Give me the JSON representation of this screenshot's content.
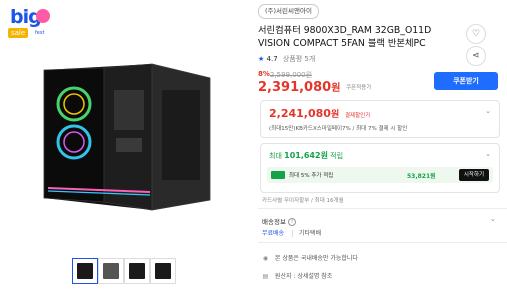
{
  "badge": {
    "big": "big",
    "sale": "sale",
    "tiny": "fest"
  },
  "store": {
    "name": "(주)서린씨앤아이"
  },
  "product": {
    "title": "서린컴퓨터 9800X3D_RAM 32GB_O11D VISION COMPACT 5FAN 블랙 반본체PC",
    "rating": "4.7",
    "review_count": "상품평 5개",
    "discount": "8%",
    "original_price": "2,599,000원",
    "price": "2,391,080",
    "price_unit": "원",
    "price_tag": "쿠폰적용가"
  },
  "actions": {
    "coupon_button": "쿠폰받기",
    "wishlist_icon": "heart-icon",
    "share_icon": "share-icon"
  },
  "benefit_price": {
    "price": "2,241,080",
    "unit": "원",
    "label": "결제할인가",
    "detail": "(최대15만)KB카드X스마일페이7% / 최대 7% 결제 시 할인"
  },
  "points": {
    "label_prefix": "최대",
    "amount": "101,642원",
    "label_suffix": "적립",
    "extra_text": "최대 5% 추가 적립",
    "extra_amount": "53,821원",
    "extra_button": "시작하기"
  },
  "card_info": "카드사별 무이자할부 / 최대 16개월",
  "shipping": {
    "label": "배송정보",
    "free": "무료배송",
    "carrier": "기타택배"
  },
  "info_rows": [
    {
      "icon": "globe-icon",
      "glyph": "◉",
      "text": "본 상품은 국내배송만 가능합니다"
    },
    {
      "icon": "doc-icon",
      "glyph": "▤",
      "text": "원산지 : 상세설명 참조"
    }
  ],
  "thumbnails": [
    {
      "selected": true
    },
    {
      "selected": false
    },
    {
      "selected": false
    },
    {
      "selected": false
    }
  ],
  "colors": {
    "accent": "#1f6dff",
    "price_red": "#e5352b",
    "point_green": "#15a34a"
  }
}
